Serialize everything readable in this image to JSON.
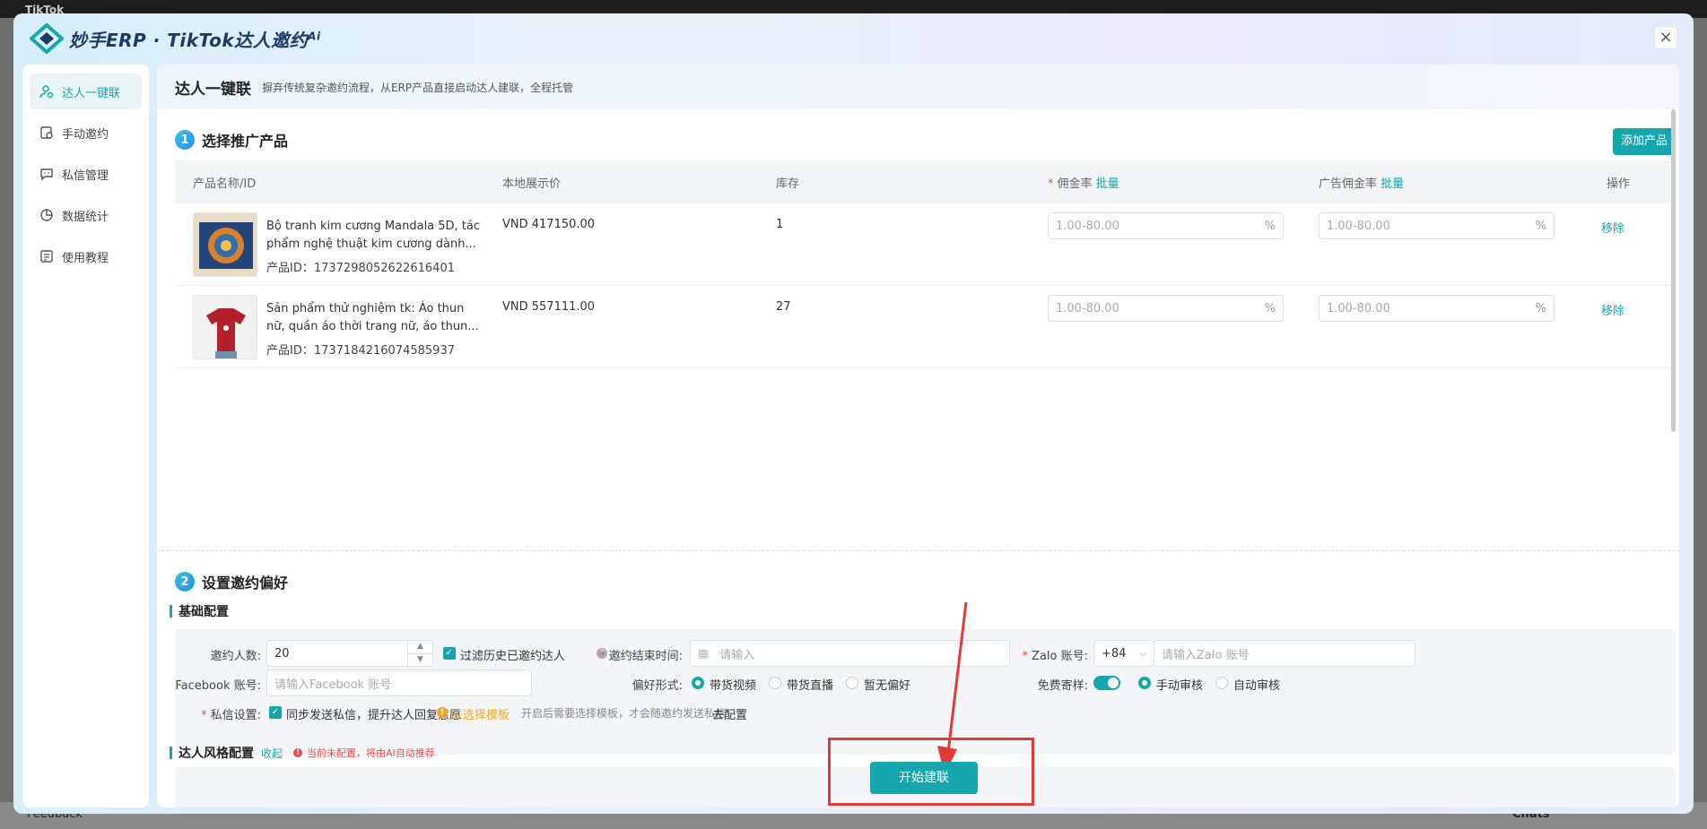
{
  "background": {
    "app_name": "TikTok",
    "feedback": "Feedback",
    "chats": "Chats"
  },
  "header": {
    "title": "妙手ERP · TikTok达人邀约",
    "title_sup": "Ai",
    "close_label": "×"
  },
  "sidebar": {
    "items": [
      {
        "label": "达人一键联",
        "icon": "user-link-icon",
        "active": true
      },
      {
        "label": "手动邀约",
        "icon": "manual-invite-icon"
      },
      {
        "label": "私信管理",
        "icon": "message-icon"
      },
      {
        "label": "数据统计",
        "icon": "chart-pie-icon"
      },
      {
        "label": "使用教程",
        "icon": "tutorial-icon"
      }
    ]
  },
  "content": {
    "title": "达人一键联",
    "desc": "摒弃传统复杂邀约流程，从ERP产品直接启动达人建联，全程托管"
  },
  "step1": {
    "num": "1",
    "title": "选择推广产品",
    "add_button": "添加产品",
    "columns": {
      "name": "产品名称/ID",
      "price": "本地展示价",
      "stock": "库存",
      "commission": "佣金率",
      "commission_batch": "批量",
      "ad_commission": "广告佣金率",
      "ad_batch": "批量",
      "action": "操作"
    },
    "rows": [
      {
        "name": "Bộ tranh kim cương Mandala 5D, tác phẩm nghệ thuật kim cương dành...",
        "id": "产品ID：1737298052622616401",
        "price": "VND 417150.00",
        "stock": "1",
        "commission_ph": "1.00-80.00",
        "ad_commission_ph": "1.00-80.00",
        "unit": "%",
        "action": "移除"
      },
      {
        "name": "Sản phẩm thử nghiệm tk: Áo thun nữ, quần áo thời trang nữ, áo thun...",
        "id": "产品ID：1737184216074585937",
        "price": "VND 557111.00",
        "stock": "27",
        "commission_ph": "1.00-80.00",
        "ad_commission_ph": "1.00-80.00",
        "unit": "%",
        "action": "移除"
      }
    ]
  },
  "step2": {
    "num": "2",
    "title": "设置邀约偏好",
    "basic": {
      "title": "基础配置",
      "invite_count_label": "邀约人数:",
      "invite_count_value": "20",
      "filter_history": "过滤历史已邀约达人",
      "end_time_label": "邀约结束时间:",
      "end_time_ph": "请输入",
      "zalo_label": "Zalo 账号:",
      "zalo_code": "+84",
      "zalo_ph": "请输入Zalo 账号",
      "facebook_label": "Facebook 账号:",
      "facebook_ph": "请输入Facebook 账号",
      "pref_label": "偏好形式:",
      "pref_options": [
        "带货视频",
        "带货直播",
        "暂无偏好"
      ],
      "sample_label": "免费寄样:",
      "sample_options": [
        "手动审核",
        "自动审核"
      ],
      "dm_label": "私信设置:",
      "dm_sync": "同步发送私信，提升达人回复意愿",
      "dm_warn": "未选择模板",
      "dm_hint": "开启后需要选择模板，才会随邀约发送私信",
      "dm_config": "去配置"
    },
    "style": {
      "title": "达人风格配置",
      "collapse": "收起",
      "warning": "当前未配置，将由AI自动推荐"
    }
  },
  "start_button": "开始建联",
  "colors": {
    "accent": "#16a6ad",
    "highlight": "#e53935"
  }
}
